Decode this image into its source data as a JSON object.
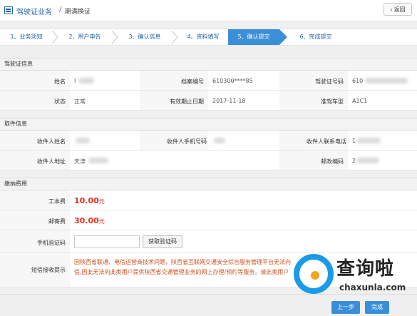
{
  "header": {
    "crumb_main": "驾驶证业务",
    "crumb_sep": "/",
    "crumb_sub": "期满换证",
    "back_label": "返回",
    "back_icon": "chevron-left-icon"
  },
  "steps": [
    {
      "label": "1、业务须知",
      "active": false
    },
    {
      "label": "2、用户申告",
      "active": false
    },
    {
      "label": "3、确认信息",
      "active": false
    },
    {
      "label": "4、资料填写",
      "active": false
    },
    {
      "label": "5、确认提交",
      "active": true
    },
    {
      "label": "6、完成提交",
      "active": false
    }
  ],
  "license_section": {
    "title": "驾驶证信息",
    "name_label": "姓名",
    "name_value": "I",
    "archive_label": "档案编号",
    "archive_value": "610300****85",
    "license_no_label": "驾驶证号码",
    "license_no_value": "610",
    "status_label": "状态",
    "status_value": "正常",
    "expiry_label": "有效期止日期",
    "expiry_value": "2017-11-18",
    "vehicle_label": "准驾车型",
    "vehicle_value": "A1C1"
  },
  "delivery_section": {
    "title": "取件信息",
    "recipient_label": "收件人姓名",
    "phone_label": "收件人手机号码",
    "contact_label": "收件人联系电话",
    "contact_value": "1",
    "address_label": "收件人地址",
    "address_value": "天津",
    "postcode_label": "邮政编码",
    "postcode_value": "2"
  },
  "fee_section": {
    "title": "缴纳费用",
    "cost_label": "工本费",
    "cost_value": "10.00",
    "cost_unit": "元",
    "postage_label": "邮寄费",
    "postage_value": "30.00",
    "postage_unit": "元",
    "code_label": "手机验证码",
    "code_placeholder": "",
    "code_button": "获取验证码",
    "sms_label": "短信接收提示",
    "sms_line1": "因陕西省联通、电信运营商技术问题，陕西省互联网交通安全综合服务管理平台无法向",
    "sms_line2": "信,因此无法向此类用户提供陕西省交通管理业务的网上办理/预约等服务。请此类用户"
  },
  "footer": {
    "prev_label": "上一步",
    "done_label": "完成"
  },
  "watermark": {
    "big_text": "查询啦",
    "small_text": "chaxunla.com"
  },
  "colors": {
    "brand_blue": "#1f5fa8",
    "step_active": "#3b8fd9",
    "fee_red": "#e0321e",
    "notice_orange": "#d0501e"
  }
}
